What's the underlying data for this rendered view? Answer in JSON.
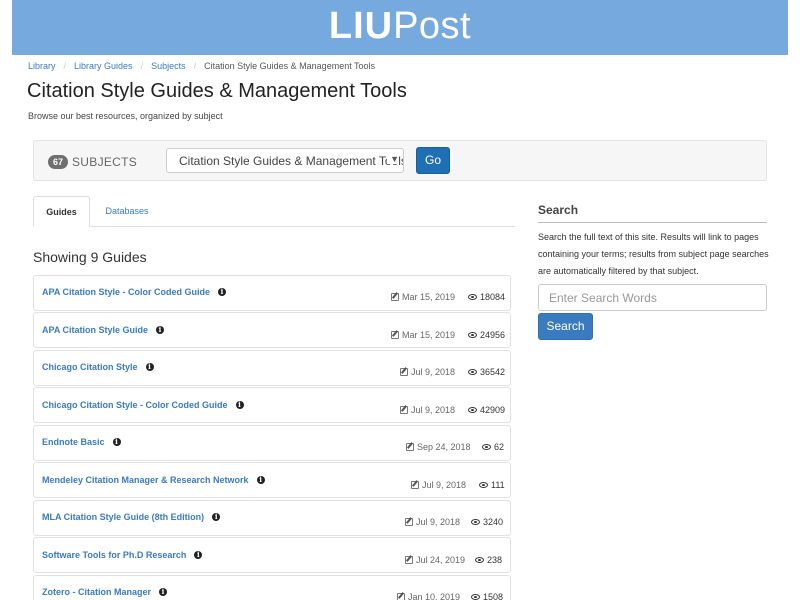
{
  "header": {
    "logo_part1": "LIU",
    "logo_part2": "Post"
  },
  "breadcrumb": [
    "Library",
    "Library Guides",
    "Subjects",
    "Citation Style Guides & Management Tools"
  ],
  "page": {
    "title": "Citation Style Guides & Management Tools",
    "subtitle": "Browse our best resources, organized by subject"
  },
  "subjects": {
    "count": "67",
    "label": "SUBJECTS",
    "selected": "Citation Style Guides & Management Tools",
    "go_label": "Go"
  },
  "tabs": [
    {
      "label": "Guides",
      "active": true
    },
    {
      "label": "Databases",
      "active": false
    }
  ],
  "guides": {
    "showing": "Showing 9 Guides",
    "items": [
      {
        "title": "APA Citation Style - Color Coded Guide",
        "date": "Mar 15, 2019",
        "views": "18084"
      },
      {
        "title": "APA Citation Style Guide",
        "date": "Mar 15, 2019",
        "views": "24956"
      },
      {
        "title": "Chicago Citation Style",
        "date": "Jul 9, 2018",
        "views": "36542"
      },
      {
        "title": "Chicago Citation Style - Color Coded Guide",
        "date": "Jul 9, 2018",
        "views": "42909"
      },
      {
        "title": "Endnote Basic",
        "date": "Sep 24, 2018",
        "views": "62"
      },
      {
        "title": "Mendeley Citation Manager & Research Network",
        "date": "Jul 9, 2018",
        "views": "111"
      },
      {
        "title": "MLA Citation Style Guide (8th Edition)",
        "date": "Jul 9, 2018",
        "views": "3240"
      },
      {
        "title": "Software Tools for Ph.D Research",
        "date": "Jul 24, 2019",
        "views": "238"
      },
      {
        "title": "Zotero - Citation Manager",
        "date": "Jan 10, 2019",
        "views": "1508"
      }
    ]
  },
  "search": {
    "heading": "Search",
    "help": "Search the full text of this site. Results will link to pages containing your terms; results from subject page searches are automatically filtered by that subject.",
    "placeholder": "Enter Search Words",
    "button": "Search"
  },
  "colors": {
    "banner": "#76a9de",
    "link": "#3a7bbf",
    "go_button": "#1f6fb5",
    "search_button": "#3a7bbf"
  }
}
